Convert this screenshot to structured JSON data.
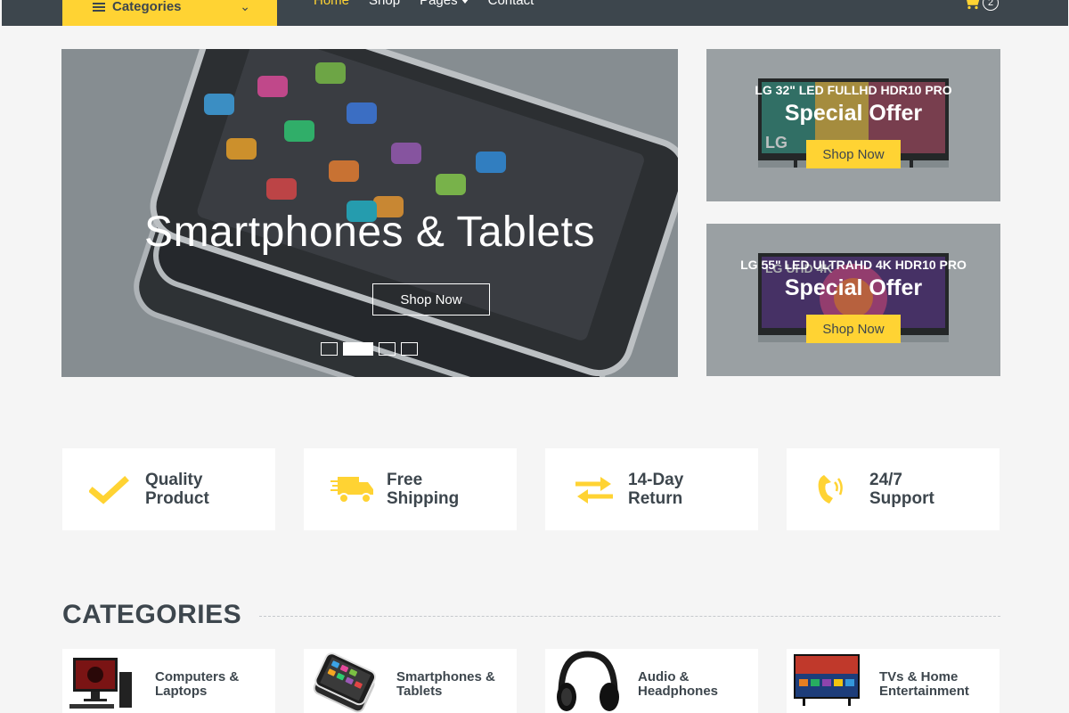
{
  "nav": {
    "categories_label": "Categories",
    "links": [
      "Home",
      "Shop",
      "Pages",
      "Contact"
    ],
    "cart_count": "2"
  },
  "hero": {
    "title": "Smartphones & Tablets",
    "button": "Shop Now",
    "slides": 4,
    "active_slide": 2
  },
  "offers": [
    {
      "subtitle": "LG 32\" LED FULLHD HDR10 PRO",
      "title": "Special Offer",
      "button": "Shop Now"
    },
    {
      "subtitle": "LG 55\" LED ULTRAHD 4K HDR10 PRO",
      "title": "Special Offer",
      "button": "Shop Now"
    }
  ],
  "features": [
    {
      "line1": "Quality",
      "line2": "Product",
      "icon": "check-icon"
    },
    {
      "line1": "Free",
      "line2": "Shipping",
      "icon": "truck-icon"
    },
    {
      "line1": "14-Day",
      "line2": "Return",
      "icon": "exchange-icon"
    },
    {
      "line1": "24/7",
      "line2": "Support",
      "icon": "phone-volume-icon"
    }
  ],
  "categories": {
    "heading": "CATEGORIES",
    "items": [
      {
        "line1": "Computers &",
        "line2": "Laptops"
      },
      {
        "line1": "Smartphones &",
        "line2": "Tablets"
      },
      {
        "line1": "Audio &",
        "line2": "Headphones"
      },
      {
        "line1": "TVs & Home",
        "line2": "Entertainment"
      }
    ]
  },
  "colors": {
    "accent": "#ffd333",
    "dark": "#3d464d",
    "background": "#f5f5f5"
  }
}
